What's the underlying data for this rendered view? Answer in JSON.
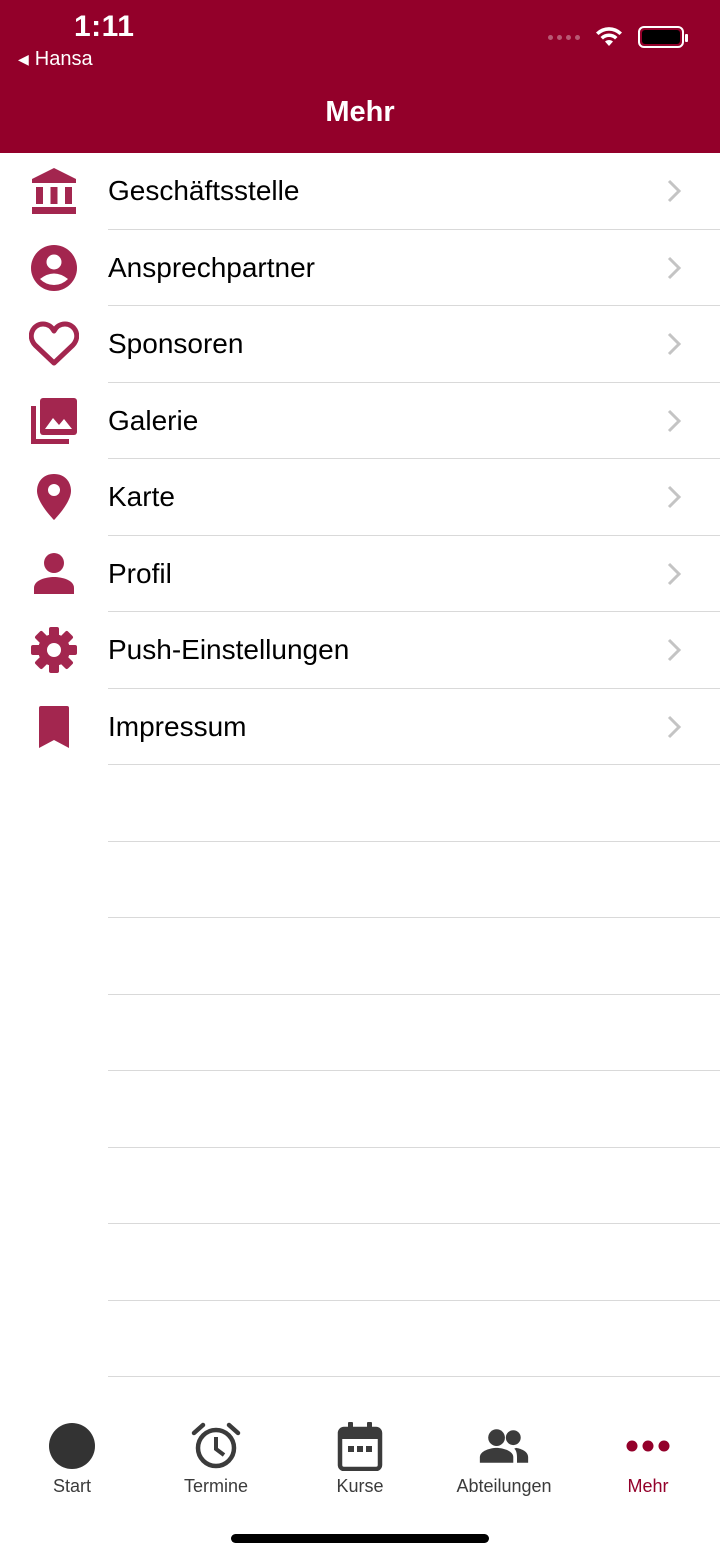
{
  "status": {
    "time": "1:11",
    "back_app": "Hansa"
  },
  "header": {
    "title": "Mehr"
  },
  "menu": [
    {
      "label": "Geschäftsstelle",
      "icon": "bank-icon"
    },
    {
      "label": "Ansprechpartner",
      "icon": "account-circle-icon"
    },
    {
      "label": "Sponsoren",
      "icon": "heart-outline-icon"
    },
    {
      "label": "Galerie",
      "icon": "photo-library-icon"
    },
    {
      "label": "Karte",
      "icon": "map-pin-icon"
    },
    {
      "label": "Profil",
      "icon": "person-icon"
    },
    {
      "label": "Push-Einstellungen",
      "icon": "gear-icon"
    },
    {
      "label": "Impressum",
      "icon": "bookmark-icon"
    }
  ],
  "tabs": [
    {
      "label": "Start",
      "icon": "circle-icon",
      "active": false
    },
    {
      "label": "Termine",
      "icon": "alarm-clock-icon",
      "active": false
    },
    {
      "label": "Kurse",
      "icon": "calendar-icon",
      "active": false
    },
    {
      "label": "Abteilungen",
      "icon": "group-icon",
      "active": false
    },
    {
      "label": "Mehr",
      "icon": "more-dots-icon",
      "active": true
    }
  ],
  "colors": {
    "brand": "#93002a",
    "icon": "#a3264f",
    "tab_inactive": "#3b3b3b",
    "chevron": "#c4c4c4"
  }
}
